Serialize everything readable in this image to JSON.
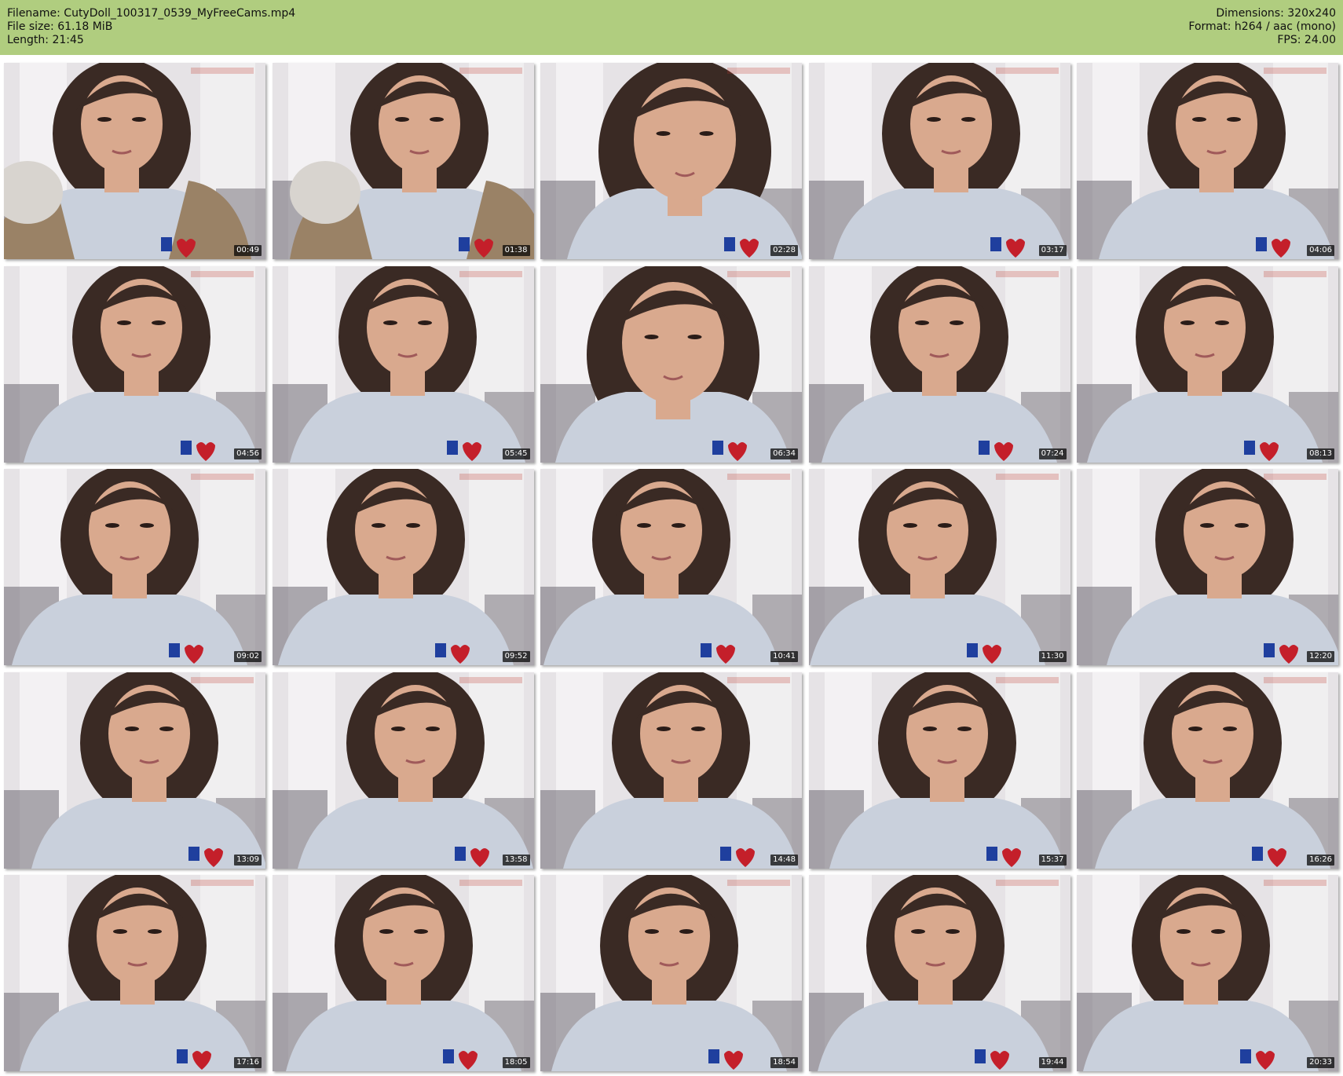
{
  "meta": {
    "filename": "Filename: CutyDoll_100317_0539_MyFreeCams.mp4",
    "file_size": "File size: 61.18 MiB",
    "length": "Length: 21:45",
    "dimensions": "Dimensions: 320x240",
    "format": "Format: h264 / aac (mono)",
    "fps": "FPS: 24.00"
  },
  "thumbnails": [
    {
      "time": "00:49"
    },
    {
      "time": "01:38"
    },
    {
      "time": "02:28"
    },
    {
      "time": "03:17"
    },
    {
      "time": "04:06"
    },
    {
      "time": "04:56"
    },
    {
      "time": "05:45"
    },
    {
      "time": "06:34"
    },
    {
      "time": "07:24"
    },
    {
      "time": "08:13"
    },
    {
      "time": "09:02"
    },
    {
      "time": "09:52"
    },
    {
      "time": "10:41"
    },
    {
      "time": "11:30"
    },
    {
      "time": "12:20"
    },
    {
      "time": "13:09"
    },
    {
      "time": "13:58"
    },
    {
      "time": "14:48"
    },
    {
      "time": "15:37"
    },
    {
      "time": "16:26"
    },
    {
      "time": "17:16"
    },
    {
      "time": "18:05"
    },
    {
      "time": "18:54"
    },
    {
      "time": "19:44"
    },
    {
      "time": "20:33"
    }
  ],
  "colors": {
    "header_bg": "#b0cd7f",
    "wall": "#e6e3e6",
    "curtain": "#f3f1f3",
    "hair": "#3a2a24",
    "skin": "#d9a98e",
    "shirt": "#c9d0dc",
    "jacket": "#9a8266",
    "fur": "#d8d4cf",
    "patch_blue": "#1f3f9e",
    "patch_red": "#c41f2a"
  }
}
